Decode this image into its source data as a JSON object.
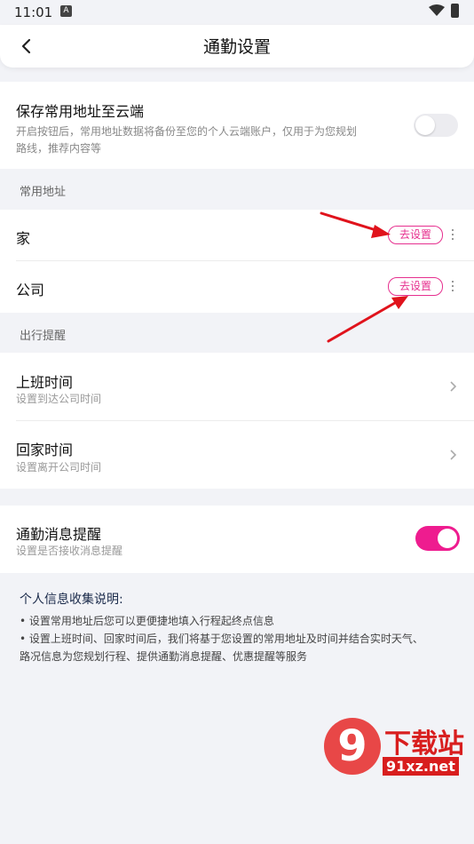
{
  "status_bar": {
    "time": "11:01",
    "notification_icon_text": "A"
  },
  "header": {
    "title": "通勤设置"
  },
  "cloud": {
    "title": "保存常用地址至云端",
    "desc_line1": "开启按钮后，常用地址数据将备份至您的个人云端账户，仅用于为您规划",
    "desc_line2": "路线，推荐内容等",
    "enabled": false
  },
  "addresses": {
    "section_label": "常用地址",
    "items": [
      {
        "label": "家",
        "action": "去设置"
      },
      {
        "label": "公司",
        "action": "去设置"
      }
    ]
  },
  "reminders": {
    "section_label": "出行提醒",
    "items": [
      {
        "title": "上班时间",
        "subtitle": "设置到达公司时间"
      },
      {
        "title": "回家时间",
        "subtitle": "设置离开公司时间"
      }
    ]
  },
  "notify": {
    "title": "通勤消息提醒",
    "subtitle": "设置是否接收消息提醒",
    "enabled": true
  },
  "info": {
    "title": "个人信息收集说明:",
    "bullet1": "设置常用地址后您可以更便捷地填入行程起终点信息",
    "bullet2_line1": "设置上班时间、回家时间后，我们将基于您设置的常用地址及时间并结合实时天气、",
    "bullet2_line2": "路况信息为您规划行程、提供通勤消息提醒、优惠提醒等服务"
  },
  "watermark": {
    "brand": "下载站",
    "domain": "91xz.net",
    "logo_text": "9"
  },
  "colors": {
    "accent": "#ee1c8f",
    "arrow": "#e0131c",
    "background": "#f2f3f7"
  }
}
